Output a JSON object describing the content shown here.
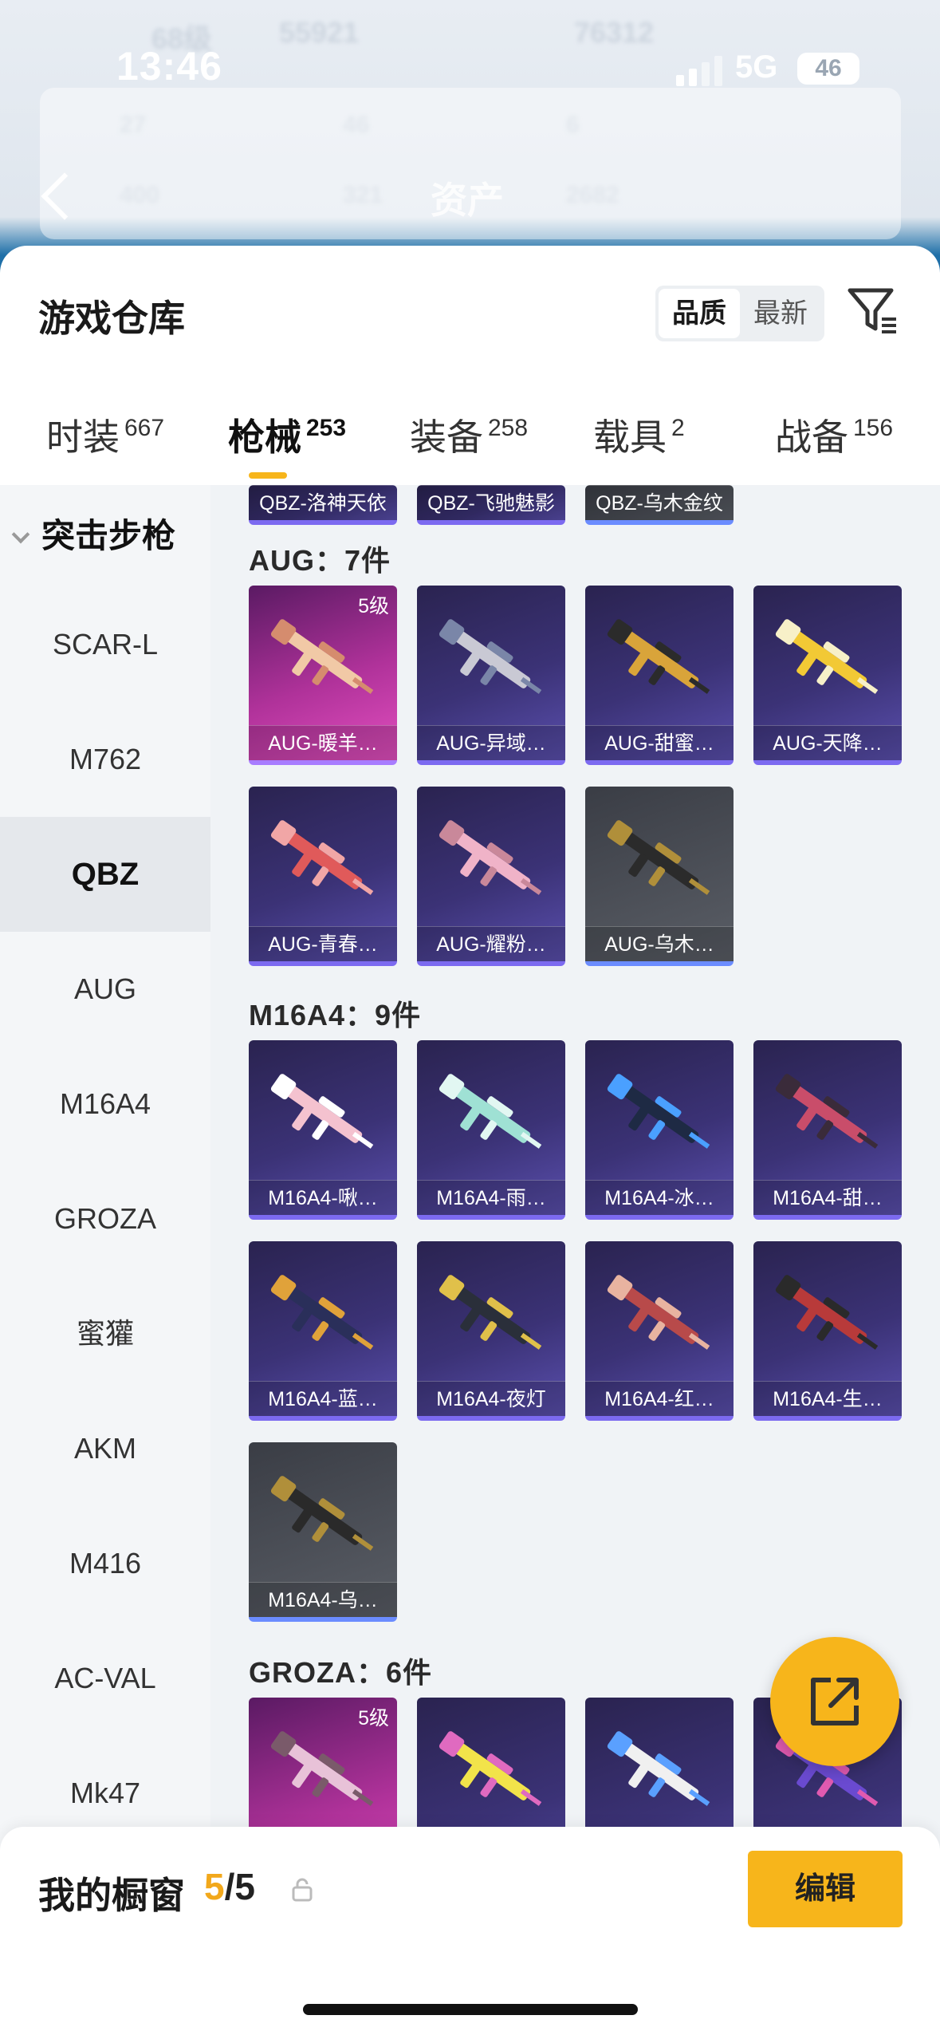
{
  "status": {
    "time": "13:46",
    "network": "5G",
    "battery": "46"
  },
  "header": {
    "title": "资产"
  },
  "background_text": [
    "68级",
    "55921",
    "76312",
    "27",
    "46",
    "6",
    "400",
    "321",
    "2682"
  ],
  "sheet": {
    "title": "游戏仓库",
    "sort": {
      "quality": "品质",
      "newest": "最新"
    }
  },
  "tabs": [
    {
      "label": "时装",
      "count": "667"
    },
    {
      "label": "枪械",
      "count": "253"
    },
    {
      "label": "装备",
      "count": "258"
    },
    {
      "label": "载具",
      "count": "2"
    },
    {
      "label": "战备",
      "count": "156"
    }
  ],
  "side": {
    "category": "突击步枪",
    "items": [
      "SCAR-L",
      "M762",
      "QBZ",
      "AUG",
      "M16A4",
      "GROZA",
      "蜜獾",
      "AKM",
      "M416",
      "AC-VAL",
      "Mk47"
    ]
  },
  "top_row": [
    "QBZ-洛神天依",
    "QBZ-飞驰魅影",
    "QBZ-乌木金纹"
  ],
  "sections": {
    "aug": {
      "title": "AUG：7件",
      "items": [
        "AUG-暖羊…",
        "AUG-异域…",
        "AUG-甜蜜…",
        "AUG-天降…",
        "AUG-青春…",
        "AUG-耀粉…",
        "AUG-乌木…"
      ],
      "level": "5级"
    },
    "m16": {
      "title": "M16A4：9件",
      "items": [
        "M16A4-啾…",
        "M16A4-雨…",
        "M16A4-冰…",
        "M16A4-甜…",
        "M16A4-蓝…",
        "M16A4-夜灯",
        "M16A4-红…",
        "M16A4-生…",
        "M16A4-乌…"
      ]
    },
    "groza": {
      "title": "GROZA：6件",
      "level": "5级"
    }
  },
  "showcase": {
    "label": "我的橱窗",
    "current": "5",
    "total": "/5",
    "edit": "编辑"
  },
  "colors": {
    "accent": "#f7b51b",
    "card_purple": "#3b3276",
    "card_pink": "#b0329a",
    "card_grey": "#5a5e66"
  }
}
